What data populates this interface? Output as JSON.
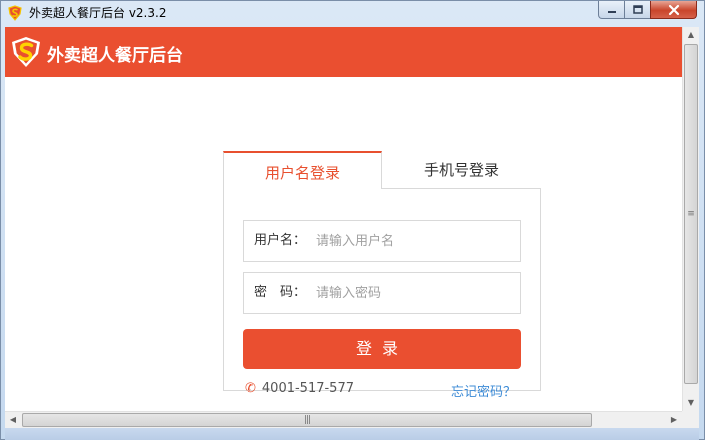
{
  "window": {
    "title": "外卖超人餐厅后台 v2.3.2",
    "logo_icon": "superman-s-shield-icon"
  },
  "header": {
    "brand_name": "外卖超人餐厅后台",
    "logo_icon": "superman-s-shield-icon",
    "background_color": "#ea4f30"
  },
  "tabs": [
    {
      "label": "用户名登录",
      "active": true
    },
    {
      "label": "手机号登录",
      "active": false
    }
  ],
  "form": {
    "username_label": "用户名：",
    "username_placeholder": "请输入用户名",
    "username_value": "",
    "password_label": "密　码：",
    "password_placeholder": "请输入密码",
    "password_value": "",
    "submit_label": "登录"
  },
  "footer": {
    "hotline": "4001-517-577",
    "phone_icon": "phone-icon",
    "forgot_password": "忘记密码？"
  },
  "colors": {
    "accent": "#ea4f30",
    "link": "#3d8bd6"
  }
}
